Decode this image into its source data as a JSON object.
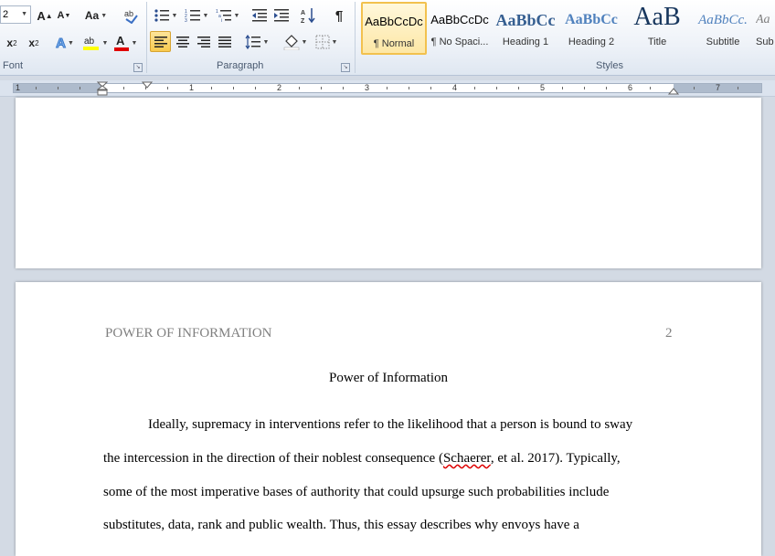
{
  "ribbon": {
    "font_size": "2",
    "groups": {
      "font": "Font",
      "paragraph": "Paragraph",
      "styles": "Styles"
    },
    "styles_gallery": [
      {
        "preview": "AaBbCcDc",
        "name": "¶ Normal"
      },
      {
        "preview": "AaBbCcDc",
        "name": "¶ No Spaci..."
      },
      {
        "preview": "AaBbCc",
        "name": "Heading 1"
      },
      {
        "preview": "AaBbCc",
        "name": "Heading 2"
      },
      {
        "preview": "AaB",
        "name": "Title"
      },
      {
        "preview": "AaBbCc.",
        "name": "Subtitle"
      },
      {
        "preview": "Aa",
        "name": "Sub"
      }
    ]
  },
  "ruler": {
    "numbers": [
      "1",
      "1",
      "2",
      "3",
      "4",
      "5",
      "6",
      "7"
    ]
  },
  "document": {
    "running_head": "POWER OF INFORMATION",
    "page_number": "2",
    "title": "Power of Information",
    "lines": [
      "Ideally, supremacy in interventions refer to the likelihood that a person is bound to sway",
      "the intercession in the direction of their noblest consequence (",
      "Schaerer",
      ", et al. 2017). Typically,",
      "some of the most imperative bases of authority that could upsurge such probabilities include",
      "substitutes, data, rank and public wealth. Thus, this essay describes why envoys have a"
    ]
  },
  "colors": {
    "accent": "#f9c94d",
    "text_highlight": "#ffff00",
    "font_color": "#e00000",
    "ribbon_text": "#4a5a70"
  }
}
